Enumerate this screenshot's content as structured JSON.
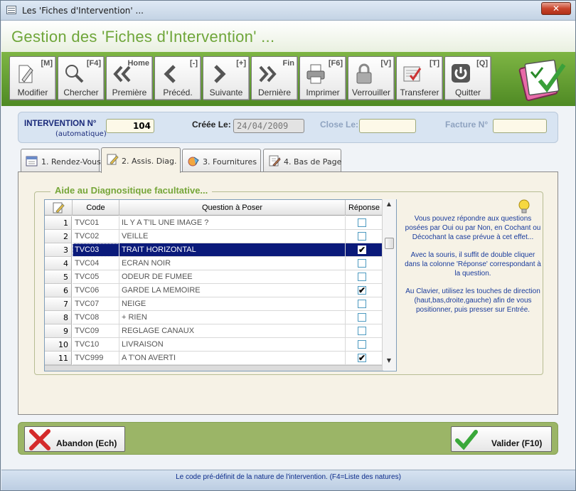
{
  "window": {
    "title": "Les 'Fiches d'Intervention' ..."
  },
  "header": {
    "title": "Gestion des 'Fiches d'Intervention' ..."
  },
  "toolbar": {
    "buttons": [
      {
        "key": "[M]",
        "label": "Modifier",
        "icon": "edit-icon"
      },
      {
        "key": "[F4]",
        "label": "Chercher",
        "icon": "search-icon"
      },
      {
        "key": "Home",
        "label": "Première",
        "icon": "first-icon"
      },
      {
        "key": "[-]",
        "label": "Précéd.",
        "icon": "previous-icon"
      },
      {
        "key": "[+]",
        "label": "Suivante",
        "icon": "next-icon"
      },
      {
        "key": "Fin",
        "label": "Dernière",
        "icon": "last-icon"
      },
      {
        "key": "[F6]",
        "label": "Imprimer",
        "icon": "printer-icon"
      },
      {
        "key": "[V]",
        "label": "Verrouiller",
        "icon": "lock-icon"
      },
      {
        "key": "[T]",
        "label": "Transferer",
        "icon": "transfer-icon"
      },
      {
        "key": "[Q]",
        "label": "Quitter",
        "icon": "power-icon"
      }
    ]
  },
  "info": {
    "intervention_label": "INTERVENTION N°",
    "intervention_sub": "(automatique)",
    "intervention_value": "104",
    "creee_label": "Créée Le:",
    "creee_value": "24/04/2009",
    "close_label": "Close Le:",
    "close_value": "",
    "facture_label": "Facture N°",
    "facture_value": ""
  },
  "tabs": [
    {
      "label": "1. Rendez-Vous",
      "icon": "calendar-icon"
    },
    {
      "label": "2. Assis. Diag.",
      "icon": "note-edit-icon"
    },
    {
      "label": "3. Fournitures",
      "icon": "supplies-icon"
    },
    {
      "label": "4. Bas de Page",
      "icon": "page-edit-icon"
    }
  ],
  "diag": {
    "group_title": "Aide au Diagnositique facultative...",
    "columns": {
      "code": "Code",
      "question": "Question à Poser",
      "reponse": "Réponse"
    },
    "rows": [
      {
        "num": "1",
        "code": "TVC01",
        "question": "IL Y A T'IL UNE IMAGE ?",
        "checked": false
      },
      {
        "num": "2",
        "code": "TVC02",
        "question": "VEILLE",
        "checked": false
      },
      {
        "num": "3",
        "code": "TVC03",
        "question": "TRAIT HORIZONTAL",
        "checked": true,
        "selected": true
      },
      {
        "num": "4",
        "code": "TVC04",
        "question": "ECRAN NOIR",
        "checked": false
      },
      {
        "num": "5",
        "code": "TVC05",
        "question": "ODEUR DE FUMEE",
        "checked": false
      },
      {
        "num": "6",
        "code": "TVC06",
        "question": "GARDE LA MEMOIRE",
        "checked": true
      },
      {
        "num": "7",
        "code": "TVC07",
        "question": "NEIGE",
        "checked": false
      },
      {
        "num": "8",
        "code": "TVC08",
        "question": "+ RIEN",
        "checked": false
      },
      {
        "num": "9",
        "code": "TVC09",
        "question": "REGLAGE CANAUX",
        "checked": false
      },
      {
        "num": "10",
        "code": "TVC10",
        "question": "LIVRAISON",
        "checked": false
      },
      {
        "num": "11",
        "code": "TVC999",
        "question": "A T'ON AVERTI",
        "checked": true
      }
    ],
    "help": [
      "Vous pouvez répondre aux questions posées par Oui ou par Non, en Cochant ou Décochant la case prévue à cet effet...",
      "Avec la souris, il suffit de double cliquer dans la colonne 'Réponse' correspondant à la question.",
      "Au Clavier, utilisez les touches de direction (haut,bas,droite,gauche) afin de vous positionner, puis presser sur Entrée."
    ]
  },
  "actions": {
    "abandon": "Abandon (Ech)",
    "valider": "Valider (F10)"
  },
  "status": {
    "message": "Le code pré-définit de la nature de l'intervention. (F4=Liste des natures)"
  },
  "colors": {
    "accent_green": "#6fa63a",
    "selection": "#0a1a7a",
    "help_text": "#1a3c9c"
  }
}
